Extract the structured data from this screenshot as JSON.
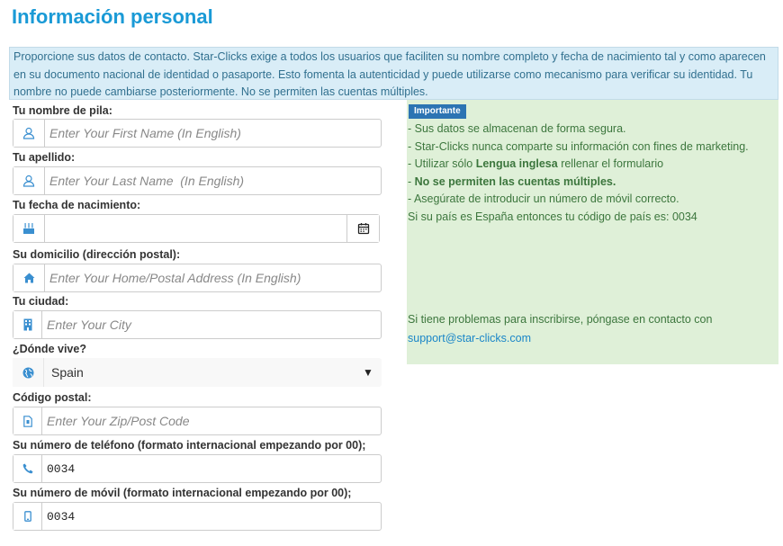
{
  "page": {
    "title": "Información personal",
    "intro": "Proporcione sus datos de contacto. Star-Clicks exige a todos los usuarios que faciliten su nombre completo y fecha de nacimiento tal y como aparecen en su documento nacional de identidad o pasaporte. Esto fomenta la autenticidad y puede utilizarse como mecanismo para verificar su identidad. Tu nombre no puede cambiarse posteriormente. No se permiten las cuentas múltiples."
  },
  "form": {
    "first_name": {
      "label": "Tu nombre de pila:",
      "placeholder": "Enter Your First Name (In English)",
      "value": "",
      "icon": "user-icon"
    },
    "last_name": {
      "label": "Tu apellido:",
      "placeholder": "Enter Your Last Name  (In English)",
      "value": "",
      "icon": "user-icon"
    },
    "birth_date": {
      "label": "Tu fecha de nacimiento:",
      "placeholder": "",
      "value": "",
      "icon": "birthday-cake-icon",
      "button_icon": "calendar-icon"
    },
    "address": {
      "label": "Su domicilio (dirección postal):",
      "placeholder": "Enter Your Home/Postal Address (In English)",
      "value": "",
      "icon": "home-icon"
    },
    "city": {
      "label": "Tu ciudad:",
      "placeholder": "Enter Your City",
      "value": "",
      "icon": "building-icon"
    },
    "country": {
      "label": "¿Dónde vive?",
      "selected": "Spain",
      "icon": "globe-icon"
    },
    "zip": {
      "label": "Código postal:",
      "placeholder": "Enter Your Zip/Post Code",
      "value": "",
      "icon": "file-icon"
    },
    "phone": {
      "label": "Su número de teléfono (formato internacional empezando por 00);",
      "value": "0034",
      "icon": "phone-icon"
    },
    "mobile": {
      "label": "Su número de móvil (formato internacional empezando por 00);",
      "value": "0034",
      "icon": "mobile-icon"
    }
  },
  "sidebar": {
    "badge": "Importante",
    "notes": [
      {
        "pre": "- Sus datos se almacenan de forma segura.",
        "bold": "",
        "post": ""
      },
      {
        "pre": "- Star-Clicks nunca comparte su información con fines de marketing.",
        "bold": "",
        "post": ""
      },
      {
        "pre": "- Utilizar sólo ",
        "bold": "Lengua inglesa",
        "post": " rellenar el formulario"
      },
      {
        "pre": "- ",
        "bold": "No se permiten las cuentas múltiples.",
        "post": ""
      },
      {
        "pre": "- Asegúrate de introducir un número de móvil correcto.",
        "bold": "",
        "post": ""
      },
      {
        "pre": "Si su país es España entonces tu código de país es: 0034",
        "bold": "",
        "post": ""
      }
    ],
    "contact_text": "Si tiene problemas para inscribirse, póngase en contacto con",
    "contact_email": "support@star-clicks.com"
  },
  "colors": {
    "title": "#1a9ad6",
    "info_bg": "#d9edf7",
    "info_text": "#31708f",
    "success_bg": "#dff0d8",
    "success_text": "#3c763d",
    "badge_bg": "#2c74b3",
    "icon_blue": "#1a86c8"
  }
}
